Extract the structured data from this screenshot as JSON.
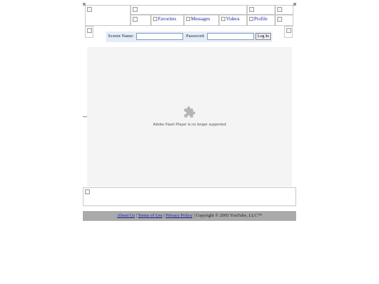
{
  "nav": {
    "favorites": "Favorites",
    "messages": "Messages",
    "videos": "Videos",
    "profile": "Profile"
  },
  "login": {
    "screen_name_label": "Screen Name:",
    "screen_name_value": "",
    "password_label": "Password:",
    "password_value": "",
    "login_button": "Log In"
  },
  "player": {
    "message": "Adobe Flash Player is no longer supported",
    "icon": "puzzle-piece-icon"
  },
  "footer": {
    "about": "About Us",
    "sep1": " | ",
    "terms": "Terms of Use",
    "sep2": " | ",
    "privacy": "Privacy Policy",
    "copyright": " | Copyright © 2005 YouTube, LLC™"
  },
  "colors": {
    "login_bg": "#e5ecf9",
    "footer_bg": "#aaaaaa",
    "player_bg": "#f4f4f4",
    "link": "#1a1aa6"
  }
}
